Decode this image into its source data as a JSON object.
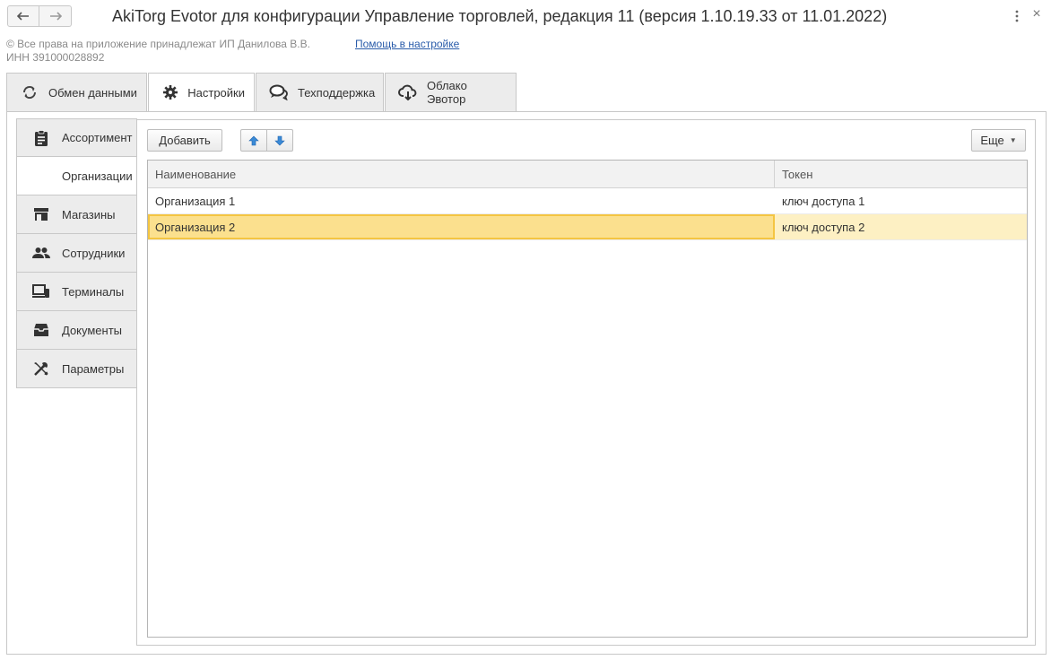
{
  "window": {
    "title": "AkiTorg Evotor для конфигурации Управление торговлей, редакция 11 (версия 1.10.19.33 от 11.01.2022)",
    "back_icon": "arrow-left-icon",
    "forward_icon": "arrow-right-icon",
    "menu_icon": "vertical-dots-icon",
    "close_glyph": "×"
  },
  "header": {
    "copyright": "© Все права на приложение принадлежат ИП Данилова В.В.",
    "help_link": "Помощь в настройке",
    "inn": "ИНН 391000028892"
  },
  "tabs": [
    {
      "label": "Обмен данными",
      "icon": "sync-icon",
      "active": false
    },
    {
      "label": "Настройки",
      "icon": "gear-icon",
      "active": true
    },
    {
      "label": "Техподдержка",
      "icon": "chat-icon",
      "active": false
    },
    {
      "label": "Облако Эвотор",
      "icon": "cloud-download-icon",
      "active": false
    }
  ],
  "sidebar": {
    "items": [
      {
        "label": "Ассортимент",
        "icon": "clipboard-icon",
        "active": false
      },
      {
        "label": "Организации",
        "icon": "",
        "active": true
      },
      {
        "label": "Магазины",
        "icon": "store-icon",
        "active": false
      },
      {
        "label": "Сотрудники",
        "icon": "people-icon",
        "active": false
      },
      {
        "label": "Терминалы",
        "icon": "devices-icon",
        "active": false
      },
      {
        "label": "Документы",
        "icon": "inbox-icon",
        "active": false
      },
      {
        "label": "Параметры",
        "icon": "tools-icon",
        "active": false
      }
    ]
  },
  "toolbar": {
    "add_label": "Добавить",
    "up_icon": "arrow-up-icon",
    "down_icon": "arrow-down-icon",
    "more_label": "Еще"
  },
  "table": {
    "columns": [
      "Наименование",
      "Токен"
    ],
    "rows": [
      {
        "name": "Организация 1",
        "token": "ключ доступа 1",
        "selected": false
      },
      {
        "name": "Организация 2",
        "token": "ключ доступа 2",
        "selected": true
      }
    ]
  },
  "colors": {
    "accent_blue": "#2a5caa",
    "selection_bg": "#fdf0c3",
    "selection_cell": "#fbe08e",
    "selection_border": "#f4c542",
    "arrow_blue": "#3a8ad6"
  }
}
